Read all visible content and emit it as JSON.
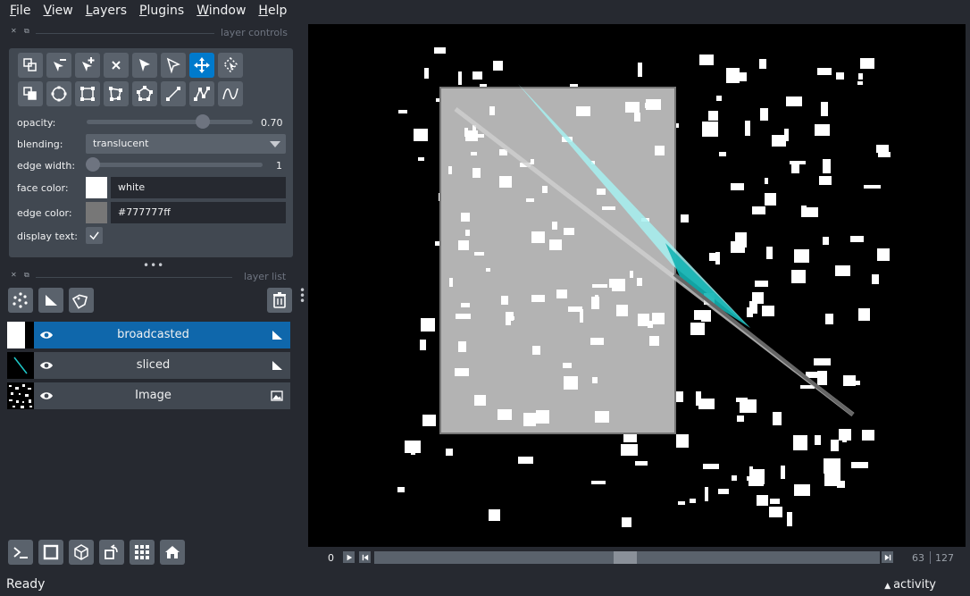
{
  "menubar": {
    "items": [
      {
        "label": "File",
        "mnemonic": "F",
        "rest": "ile"
      },
      {
        "label": "View",
        "mnemonic": "V",
        "rest": "iew"
      },
      {
        "label": "Layers",
        "mnemonic": "L",
        "rest": "ayers"
      },
      {
        "label": "Plugins",
        "mnemonic": "P",
        "rest": "lugins"
      },
      {
        "label": "Window",
        "mnemonic": "W",
        "rest": "indow"
      },
      {
        "label": "Help",
        "mnemonic": "H",
        "rest": "elp"
      }
    ]
  },
  "layer_controls": {
    "title": "layer controls",
    "opacity": {
      "label": "opacity:",
      "value": "0.70",
      "fraction": 0.7
    },
    "blending": {
      "label": "blending:",
      "value": "translucent"
    },
    "edge_width": {
      "label": "edge width:",
      "value": "1",
      "fraction": 0.0
    },
    "face_color": {
      "label": "face color:",
      "value": "white",
      "swatch": "#ffffff"
    },
    "edge_color": {
      "label": "edge color:",
      "value": "#777777ff",
      "swatch": "#777777"
    },
    "display_text": {
      "label": "display text:",
      "checked": true
    },
    "tools": [
      "shape-move-back-icon",
      "delete-vertex-icon",
      "add-vertex-icon",
      "delete-shape-icon",
      "select-shape-icon",
      "select-vertex-icon",
      "pan-zoom-icon",
      "transform-icon",
      "shape-move-front-icon",
      "ellipse-icon",
      "rectangle-icon",
      "polygon-icon",
      "lasso-icon",
      "line-icon",
      "path-icon",
      "polyline-icon"
    ]
  },
  "layer_list": {
    "title": "layer list",
    "layers": [
      {
        "name": "broadcasted",
        "type_icon": "shapes-layer-icon",
        "selected": true
      },
      {
        "name": "sliced",
        "type_icon": "shapes-layer-icon",
        "selected": false
      },
      {
        "name": "Image",
        "type_icon": "image-layer-icon",
        "selected": false
      }
    ]
  },
  "dims": {
    "current": "0",
    "value": "63",
    "max": "127"
  },
  "status": {
    "text": "Ready",
    "activity": "activity"
  },
  "colors": {
    "accent": "#0f67ab",
    "panel": "#414851",
    "background": "#262930",
    "button": "#5a626c"
  }
}
